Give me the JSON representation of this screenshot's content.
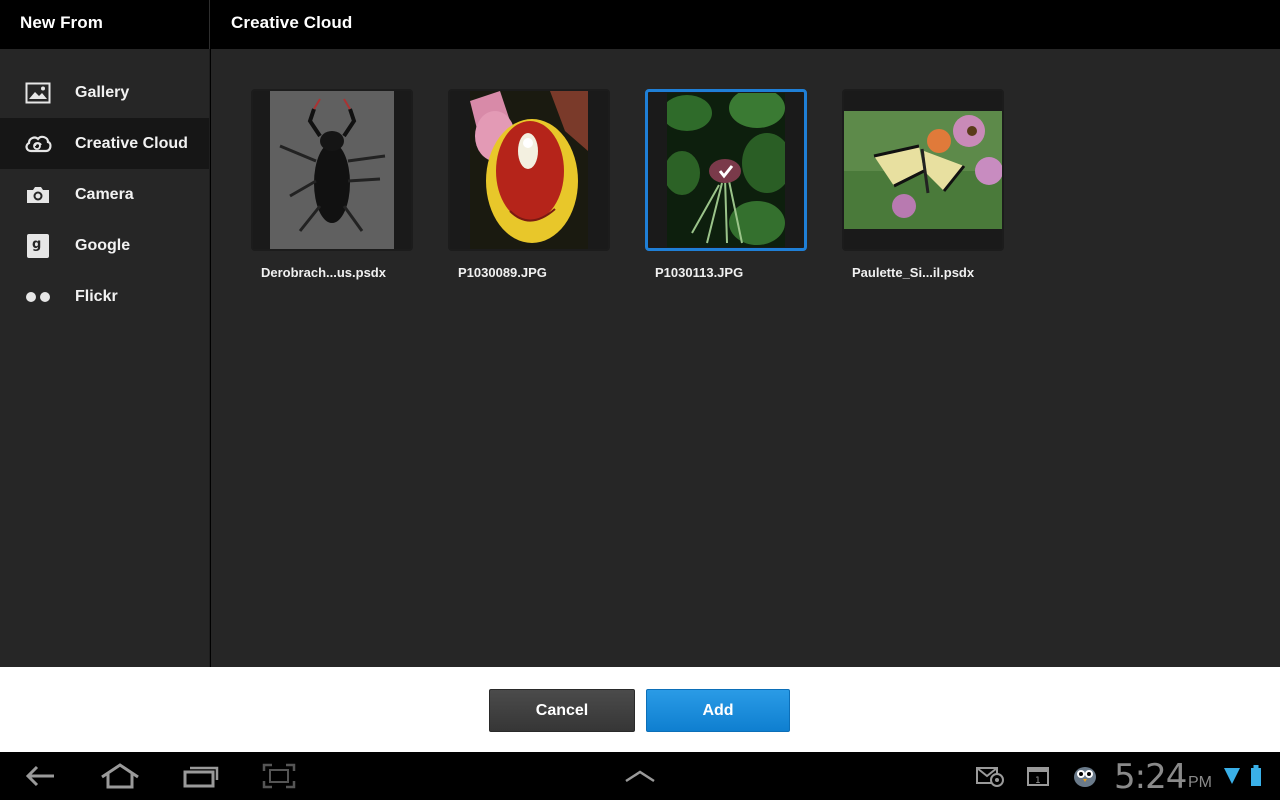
{
  "header": {
    "left_title": "New From",
    "right_title": "Creative Cloud"
  },
  "sidebar": {
    "items": [
      {
        "label": "Gallery",
        "icon": "gallery-icon"
      },
      {
        "label": "Creative Cloud",
        "icon": "creative-cloud-icon",
        "active": true
      },
      {
        "label": "Camera",
        "icon": "camera-icon"
      },
      {
        "label": "Google",
        "icon": "google-icon"
      },
      {
        "label": "Flickr",
        "icon": "flickr-icon"
      }
    ]
  },
  "files": [
    {
      "name": "Derobrach...us.psdx",
      "selected": false
    },
    {
      "name": "P1030089.JPG",
      "selected": false
    },
    {
      "name": "P1030113.JPG",
      "selected": true
    },
    {
      "name": "Paulette_Si...il.psdx",
      "selected": false
    }
  ],
  "actions": {
    "cancel_label": "Cancel",
    "add_label": "Add"
  },
  "status": {
    "time": "5:24",
    "ampm": "PM"
  },
  "colors": {
    "accent": "#1f7fd6",
    "background": "#262626",
    "header": "#000000"
  }
}
